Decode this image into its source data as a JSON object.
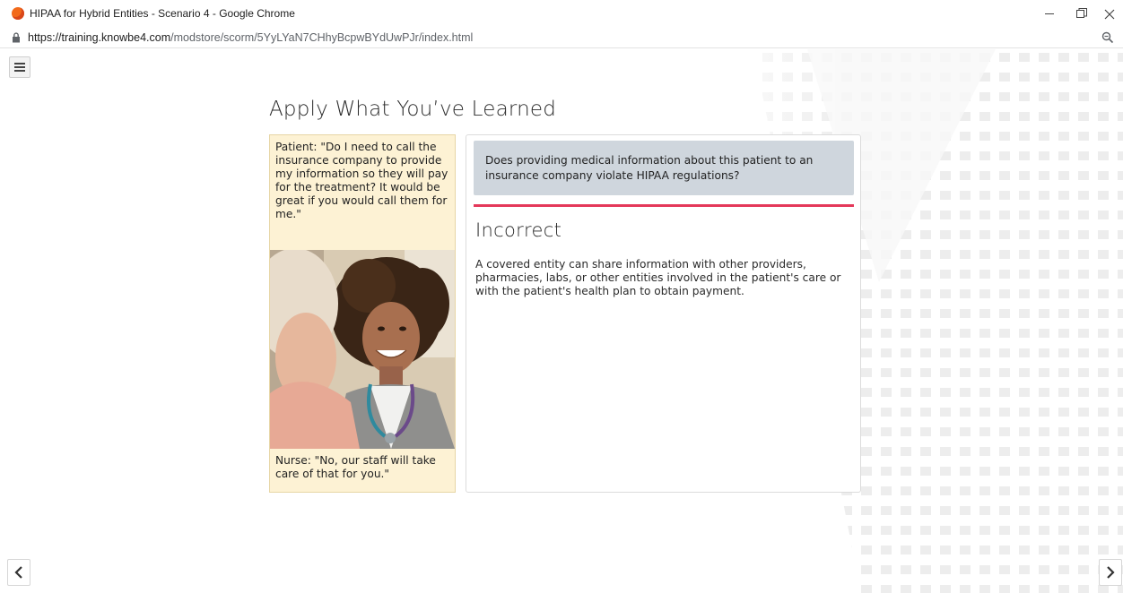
{
  "window": {
    "title": "HIPAA for Hybrid Entities - Scenario 4 - Google Chrome"
  },
  "address": {
    "url_host": "https://training.knowbe4.com",
    "url_path": "/modstore/scorm/5YyLYaN7CHhyBcpwBYdUwPJr/index.html"
  },
  "page": {
    "heading": "Apply What You’ve Learned"
  },
  "story": {
    "patient_quote": "Patient: \"Do I need to call the insurance company to provide my information so they will pay for the treatment? It would be great if you would call them for me.\"",
    "nurse_quote": "Nurse: \"No, our staff will take care of that for you.\""
  },
  "question": {
    "text": "Does providing medical information about this patient to an insurance company violate HIPAA regulations?",
    "result_title": "Incorrect",
    "feedback": "A covered entity can share information with other providers, pharmacies, labs, or other entities involved in the patient's care or with the patient's health plan to obtain payment."
  },
  "colors": {
    "result_bar": "#e4385a",
    "question_bg": "#cfd6dd",
    "story_bg": "#fdf2d4"
  },
  "icons": {
    "menu": "hamburger-menu-icon",
    "prev": "chevron-left-icon",
    "next": "chevron-right-icon",
    "lock": "lock-icon",
    "zoom": "zoom-icon"
  }
}
